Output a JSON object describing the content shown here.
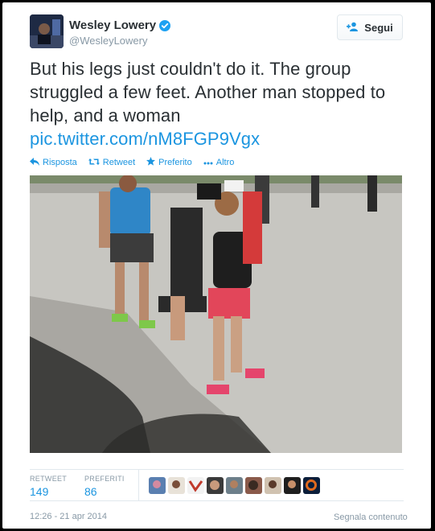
{
  "tweet": {
    "author_name": "Wesley Lowery",
    "author_handle": "@WesleyLowery",
    "follow_label": "Segui",
    "text": "But his legs just couldn't do it. The group struggled a few feet. Another man stopped to help, and a woman",
    "link": "pic.twitter.com/nM8FGP9Vgx",
    "actions": {
      "reply": "Risposta",
      "retweet": "Retweet",
      "favorite": "Preferito",
      "more": "Altro"
    },
    "stats": {
      "retweets_label": "RETWEET",
      "retweets": "149",
      "favorites_label": "PREFERITI",
      "favorites": "86"
    },
    "timestamp": "12:26 - 21 apr 2014",
    "report_label": "Segnala contenuto"
  },
  "colors": {
    "link": "#1b95e0",
    "muted": "#8899a6",
    "text": "#292f33",
    "verified": "#1da1f2"
  },
  "icons": {
    "verified": "verified-badge-icon",
    "follow": "add-user-icon",
    "reply": "reply-icon",
    "retweet": "retweet-icon",
    "favorite": "star-icon",
    "more": "ellipsis-icon"
  }
}
